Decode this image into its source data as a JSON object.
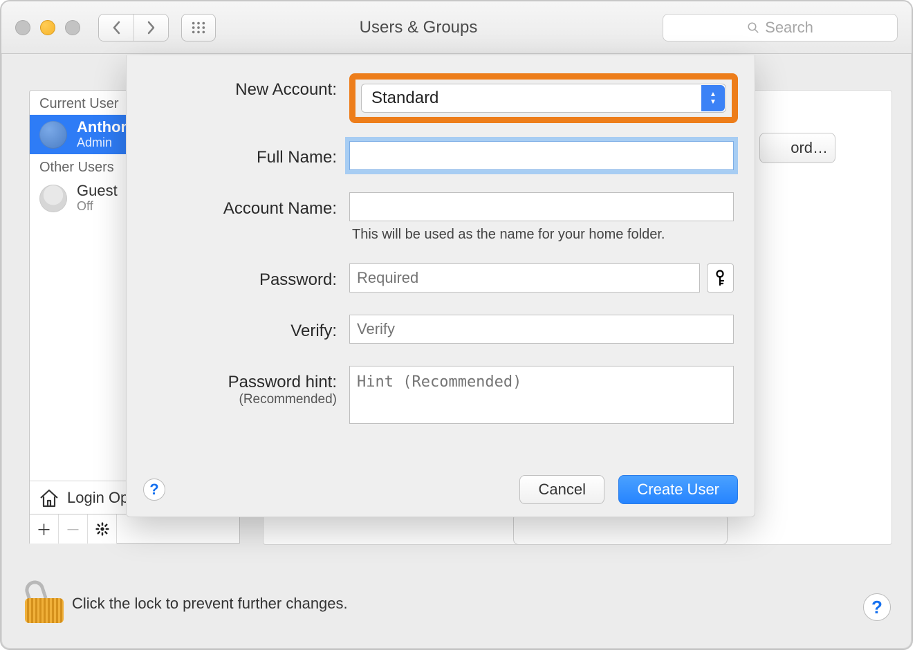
{
  "window": {
    "title": "Users & Groups",
    "search_placeholder": "Search"
  },
  "sidebar": {
    "current_label": "Current User",
    "other_label": "Other Users",
    "current": {
      "name": "Anthony",
      "role": "Admin"
    },
    "others": [
      {
        "name": "Guest",
        "status": "Off"
      }
    ],
    "login_options": "Login Options"
  },
  "peek": {
    "change_password": "ord…"
  },
  "sheet": {
    "labels": {
      "new_account": "New Account:",
      "full_name": "Full Name:",
      "account_name": "Account Name:",
      "password": "Password:",
      "verify": "Verify:",
      "hint": "Password hint:",
      "hint_sub": "(Recommended)"
    },
    "values": {
      "new_account": "Standard",
      "full_name": "",
      "account_name": "",
      "password_placeholder": "Required",
      "verify_placeholder": "Verify",
      "hint_placeholder": "Hint (Recommended)"
    },
    "account_name_note": "This will be used as the name for your home folder.",
    "buttons": {
      "cancel": "Cancel",
      "create": "Create User"
    }
  },
  "footer": {
    "text": "Click the lock to prevent further changes."
  }
}
